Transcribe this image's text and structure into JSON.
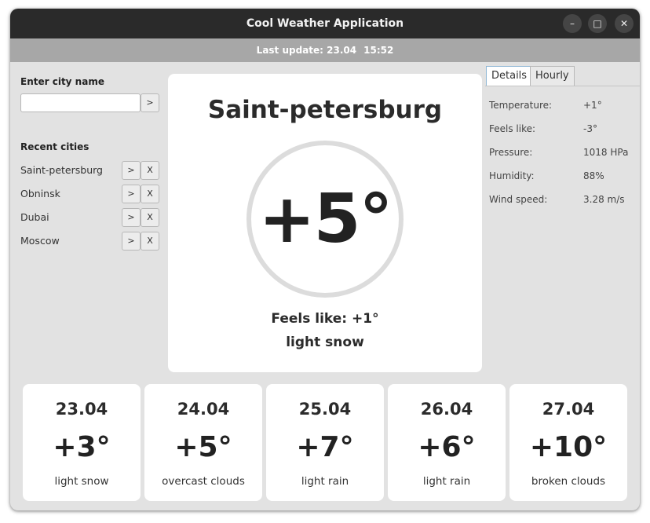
{
  "window": {
    "title": "Cool Weather Application"
  },
  "controls": {
    "minimize": "–",
    "maximize": "□",
    "close": "✕"
  },
  "status": {
    "label": "Last update:",
    "date": "23.04",
    "time": "15:52"
  },
  "search": {
    "label": "Enter city name",
    "value": "",
    "go": ">"
  },
  "recent": {
    "label": "Recent cities",
    "items": [
      {
        "name": "Saint-petersburg",
        "open": ">",
        "remove": "X"
      },
      {
        "name": "Obninsk",
        "open": ">",
        "remove": "X"
      },
      {
        "name": "Dubai",
        "open": ">",
        "remove": "X"
      },
      {
        "name": "Moscow",
        "open": ">",
        "remove": "X"
      }
    ]
  },
  "current": {
    "city": "Saint-petersburg",
    "temperature": "+5°",
    "feels_like": "Feels like: +1°",
    "description": "light snow"
  },
  "tabs": [
    "Details",
    "Hourly"
  ],
  "details": [
    {
      "label": "Temperature:",
      "value": "+1°"
    },
    {
      "label": "Feels like:",
      "value": "-3°"
    },
    {
      "label": "Pressure:",
      "value": "1018 HPa"
    },
    {
      "label": "Humidity:",
      "value": "88%"
    },
    {
      "label": "Wind speed:",
      "value": "3.28 m/s"
    }
  ],
  "forecast": [
    {
      "date": "23.04",
      "temp": "+3°",
      "cond": "light snow"
    },
    {
      "date": "24.04",
      "temp": "+5°",
      "cond": "overcast clouds"
    },
    {
      "date": "25.04",
      "temp": "+7°",
      "cond": "light rain"
    },
    {
      "date": "26.04",
      "temp": "+6°",
      "cond": "light rain"
    },
    {
      "date": "27.04",
      "temp": "+10°",
      "cond": "broken clouds"
    }
  ],
  "colors": {
    "titlebar": "#2a2a2a",
    "statusbar": "#a7a7a7",
    "window_bg": "#e2e2e2",
    "card": "#ffffff",
    "active_tab": "#8fb6d4"
  }
}
